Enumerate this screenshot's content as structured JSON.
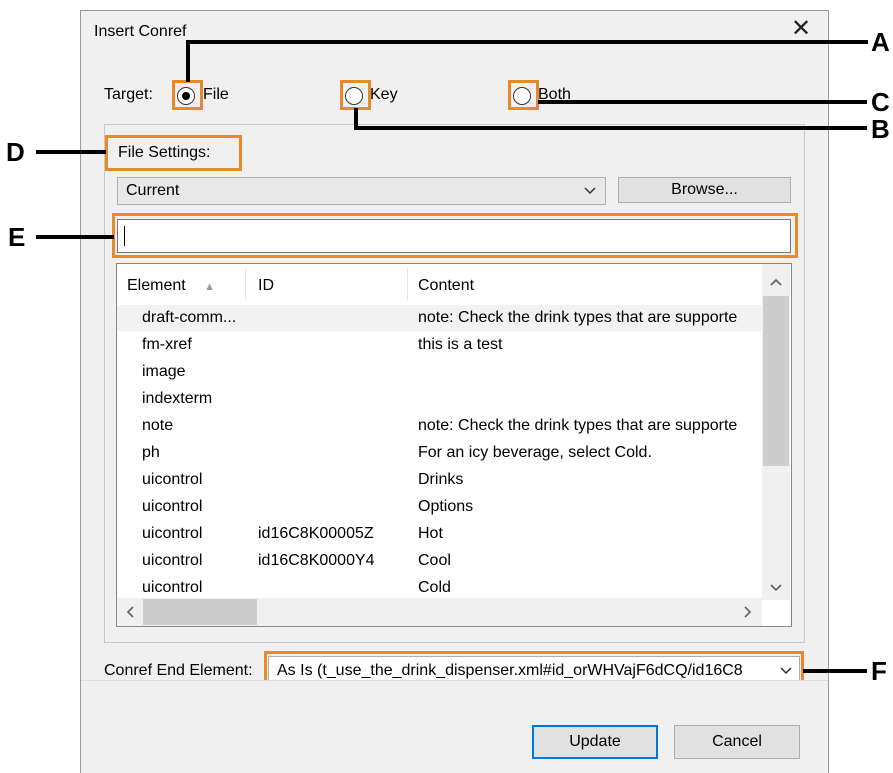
{
  "dialog": {
    "title": "Insert Conref",
    "close_glyph": "✕"
  },
  "target": {
    "label": "Target:",
    "options": [
      {
        "label": "File",
        "checked": true
      },
      {
        "label": "Key",
        "checked": false
      },
      {
        "label": "Both",
        "checked": false
      }
    ]
  },
  "file_settings": {
    "label": "File Settings:",
    "file_combo_value": "Current",
    "browse_label": "Browse...",
    "search_value": ""
  },
  "table": {
    "columns": [
      "Element",
      "ID",
      "Content"
    ],
    "sort_glyph": "▲",
    "rows": [
      {
        "element": "draft-comm...",
        "id": "",
        "content": "note:  Check the drink types that are supporte",
        "selected": true
      },
      {
        "element": "fm-xref",
        "id": "",
        "content": "this is a test"
      },
      {
        "element": "image",
        "id": "",
        "content": ""
      },
      {
        "element": "indexterm",
        "id": "",
        "content": ""
      },
      {
        "element": "note",
        "id": "",
        "content": "note:  Check the drink types that are supporte"
      },
      {
        "element": "ph",
        "id": "",
        "content": "For an icy beverage, select Cold."
      },
      {
        "element": "uicontrol",
        "id": "",
        "content": "Drinks"
      },
      {
        "element": "uicontrol",
        "id": "",
        "content": "Options"
      },
      {
        "element": "uicontrol",
        "id": "id16C8K00005Z",
        "content": "Hot"
      },
      {
        "element": "uicontrol",
        "id": "id16C8K0000Y4",
        "content": "Cool"
      },
      {
        "element": "uicontrol",
        "id": "",
        "content": "Cold"
      }
    ]
  },
  "conref_end": {
    "label": "Conref End Element:",
    "value": "As Is (t_use_the_drink_dispenser.xml#id_orWHVajF6dCQ/id16C8"
  },
  "buttons": {
    "update": "Update",
    "cancel": "Cancel"
  },
  "callouts": {
    "A": "A",
    "B": "B",
    "C": "C",
    "D": "D",
    "E": "E",
    "F": "F"
  },
  "colors": {
    "callout": "#e8892b",
    "dialog_bg": "#f0f0f0",
    "default_button_border": "#0078d7"
  },
  "icons": {
    "combo_chevron": "chevron-down-icon",
    "scroll_up": "chevron-up-icon",
    "scroll_down": "chevron-down-icon",
    "scroll_left": "chevron-left-icon",
    "scroll_right": "chevron-right-icon"
  }
}
